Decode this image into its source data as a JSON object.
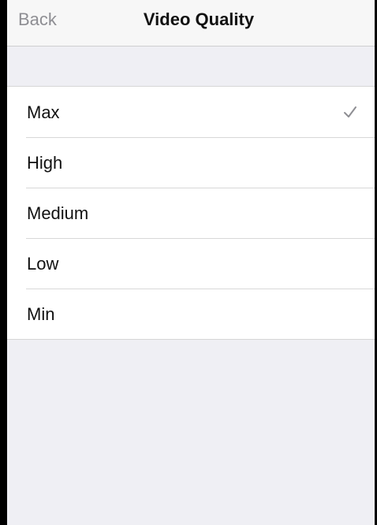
{
  "navbar": {
    "back_label": "Back",
    "title": "Video Quality"
  },
  "options": [
    {
      "label": "Max",
      "selected": true
    },
    {
      "label": "High",
      "selected": false
    },
    {
      "label": "Medium",
      "selected": false
    },
    {
      "label": "Low",
      "selected": false
    },
    {
      "label": "Min",
      "selected": false
    }
  ],
  "icons": {
    "check": "checkmark-icon"
  },
  "colors": {
    "background": "#efeff4",
    "check": "#8e8e93",
    "back_text": "#8e8e93"
  }
}
